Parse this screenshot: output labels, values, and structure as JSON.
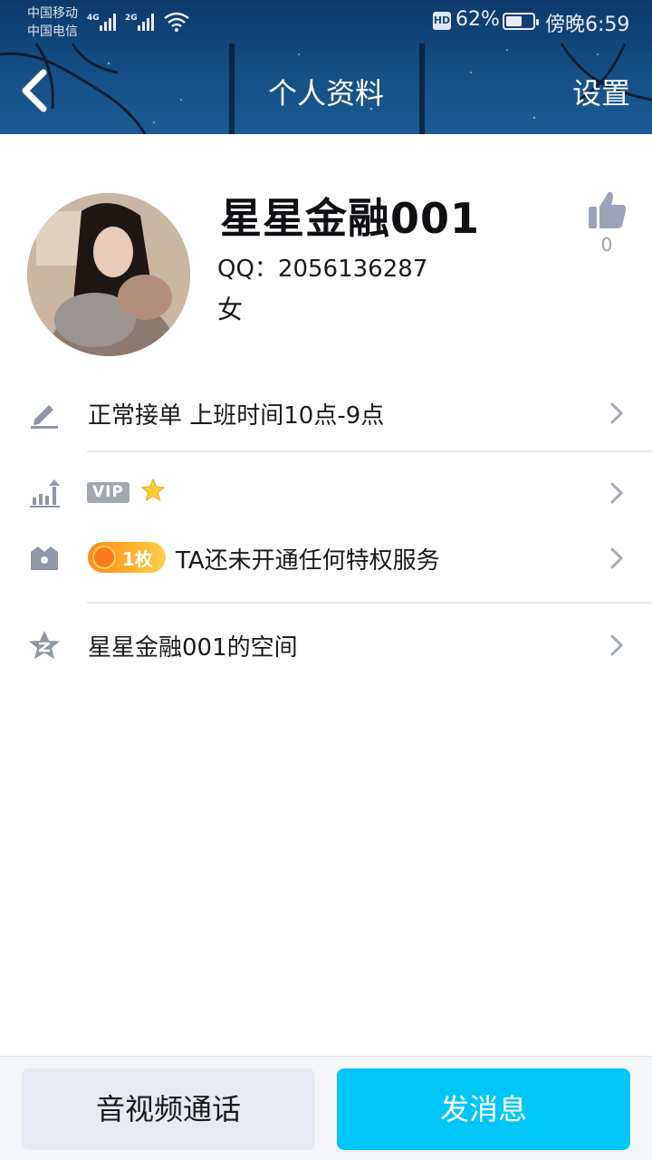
{
  "status_bar": {
    "carrier_1": "中国移动",
    "carrier_2": "中国电信",
    "net_1": "4G",
    "net_2": "2G",
    "hd": "HD",
    "battery_percent": "62%",
    "battery_level": 0.62,
    "time": "傍晚6:59"
  },
  "header": {
    "title": "个人资料",
    "settings_label": "设置",
    "back_icon": "chevron-left-icon"
  },
  "profile": {
    "name": "星星金融001",
    "qq": "QQ：2056136287",
    "gender": "女",
    "like_count": "0",
    "like_icon": "thumbs-up-icon"
  },
  "rows": {
    "signature": {
      "icon": "pencil-icon",
      "text": "正常接单 上班时间10点-9点"
    },
    "vip": {
      "icon": "level-chart-icon",
      "badge": "VIP",
      "star_icon": "star-icon"
    },
    "privilege": {
      "icon": "crown-box-icon",
      "coin_label": "1枚",
      "text": "TA还未开通任何特权服务"
    },
    "space": {
      "icon": "qzone-star-icon",
      "text": "星星金融001的空间"
    }
  },
  "bottom": {
    "call_label": "音视频通话",
    "message_label": "发消息"
  },
  "colors": {
    "header_bg": "#154f86",
    "primary_button": "#00c6f8",
    "secondary_button": "#e7eaf2",
    "icon_gray": "#8e96a8",
    "coin_orange": "#ff9a20"
  }
}
